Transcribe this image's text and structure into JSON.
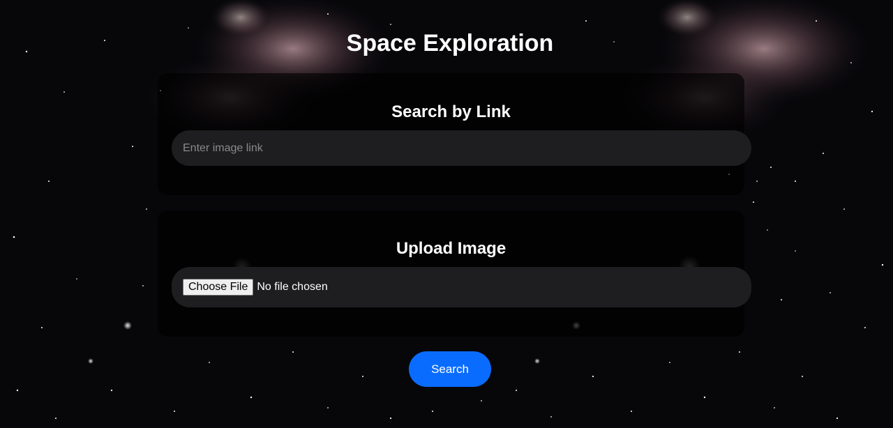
{
  "header": {
    "title": "Space Exploration"
  },
  "link_search": {
    "heading": "Search by Link",
    "placeholder": "Enter image link",
    "value": ""
  },
  "upload": {
    "heading": "Upload Image",
    "button_label": "Choose File",
    "status_text": "No file chosen"
  },
  "actions": {
    "search_label": "Search"
  },
  "colors": {
    "background": "#07070a",
    "panel": "#000000",
    "input_pill": "#1e1e20",
    "accent": "#0a6cff",
    "text": "#ffffff"
  }
}
